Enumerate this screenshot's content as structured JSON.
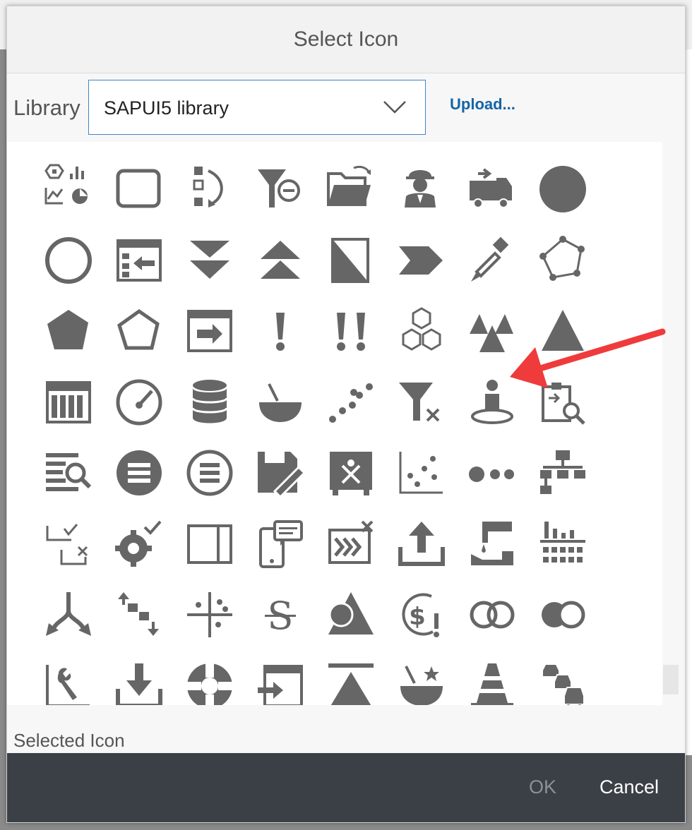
{
  "dialog": {
    "title": "Select Icon",
    "library_label": "Library",
    "library_value": "SAPUI5 library",
    "upload_label": "Upload...",
    "selected_icon_label": "Selected Icon",
    "ok_label": "OK",
    "cancel_label": "Cancel"
  },
  "icon_color": "#666666",
  "accent_color": "#3f86c9",
  "annotation_color": "#ef3b3b",
  "icons": [
    "multiple-charts-icon",
    "rectangle-outline-icon",
    "sort-steps-icon",
    "clear-filter-icon",
    "open-folder-sync-icon",
    "worker-icon",
    "tow-truck-icon",
    "filled-circle-icon",
    "circle-outline-icon",
    "calendar-move-left-icon",
    "collapse-down-icon",
    "expand-up-icon",
    "diagonal-split-icon",
    "chevron-shape-icon",
    "eyedropper-icon",
    "polygon-points-icon",
    "filled-pentagon-icon",
    "pentagon-outline-icon",
    "calendar-forward-icon",
    "exclamation-icon",
    "double-exclamation-icon",
    "hexagon-cluster-icon",
    "mountains-icon",
    "filled-triangle-icon",
    "calendar-grid-icon",
    "gauge-icon",
    "database-stack-icon",
    "bowl-spoon-icon",
    "dot-trail-icon",
    "filter-remove-icon",
    "person-placeholder-icon",
    "transfer-search-icon",
    "list-search-icon",
    "menu-circle-icon",
    "menu-circle-outline-icon",
    "save-edit-icon",
    "board-remove-icon",
    "scatter-chart-icon",
    "dot-progress-icon",
    "org-chart-icon",
    "check-remove-list-icon",
    "gear-check-icon",
    "sidebar-panel-icon",
    "phone-message-icon",
    "flow-remove-icon",
    "upload-icon",
    "water-tap-icon",
    "bar-chart-grid-icon",
    "split-arrows-icon",
    "stair-steps-icon",
    "quadrant-dots-icon",
    "currency-s-icon",
    "circle-triangle-icon",
    "dollar-alert-icon",
    "outline-circles-icon",
    "filled-circles-icon",
    "wrench-chart-icon",
    "download-icon",
    "lifebuoy-icon",
    "calendar-import-icon",
    "triangle-bar-icon",
    "bowl-star-icon",
    "traffic-cone-icon",
    "traffic-jam-icon"
  ]
}
